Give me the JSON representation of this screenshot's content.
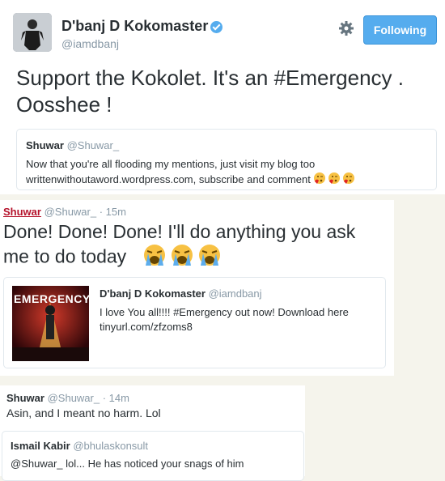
{
  "tweet1": {
    "name": "D'banj D Kokomaster",
    "handle": "@iamdbanj",
    "follow_label": "Following",
    "text_line1": "Support the Kokolet. It's an #Emergency .",
    "text_line2": "Oosshee !",
    "quote": {
      "name": "Shuwar",
      "handle": "@Shuwar_",
      "line1": "Now that you're all flooding my mentions, just visit my blog too",
      "line2": "writtenwithoutaword.wordpress.com, subscribe and comment"
    }
  },
  "tweet2": {
    "name": "Shuwar",
    "handle": "@Shuwar_",
    "time": "· 15m",
    "text_line1": "Done! Done! Done! I'll do anything you ask",
    "text_line2": "me to do today",
    "quote": {
      "name": "D'banj D Kokomaster",
      "handle": "@iamdbanj",
      "line1": "I love You all!!!! #Emergency out now! Download here",
      "line2": "tinyurl.com/zfzoms8",
      "image_text": "EMERGENCY"
    }
  },
  "tweet3": {
    "name": "Shuwar",
    "handle": "@Shuwar_",
    "time": "· 14m",
    "text": "Asin, and I meant no harm. Lol",
    "quote": {
      "name": "Ismail Kabir",
      "handle": "@bhulaskonsult",
      "text": "@Shuwar_ lol... He has noticed your snags of him"
    }
  },
  "colors": {
    "accent": "#55acee",
    "text": "#292f33",
    "muted": "#8899a6",
    "link_red": "#b5122b"
  },
  "icons": [
    "gear-icon",
    "verified-icon",
    "kissing-face-icon",
    "crying-face-icon"
  ]
}
